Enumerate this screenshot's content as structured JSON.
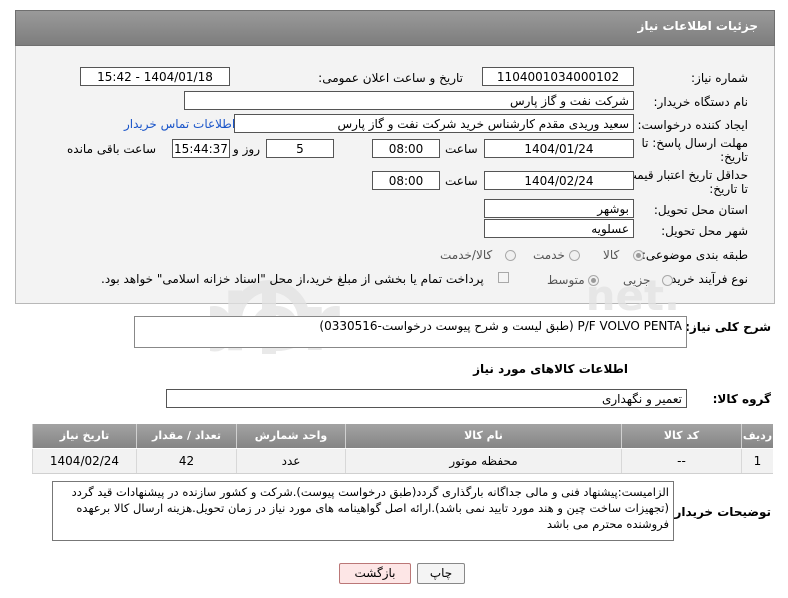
{
  "header": {
    "title": "جزئیات اطلاعات نیاز"
  },
  "fields": {
    "need_number_label": "شماره نیاز:",
    "need_number": "1104001034000102",
    "announce_label": "تاریخ و ساعت اعلان عمومی:",
    "announce_value": "1404/01/18 - 15:42",
    "buyer_org_label": "نام دستگاه خریدار:",
    "buyer_org": "شرکت نفت و گاز پارس",
    "creator_label": "ایجاد کننده درخواست:",
    "creator": "سعید وریدی مقدم کارشناس خرید شرکت نفت و گاز پارس",
    "contact_link": "اطلاعات تماس خریدار",
    "reply_deadline_label_1": "مهلت ارسال پاسخ: تا",
    "reply_deadline_label_2": "تاریخ:",
    "reply_date": "1404/01/24",
    "hour_label": "ساعت",
    "reply_time": "08:00",
    "days_value": "5",
    "days_label": "روز و",
    "remaining_time": "15:44:37",
    "remaining_label": "ساعت باقی مانده",
    "price_valid_label_1": "حداقل تاریخ اعتبار قیمت:",
    "price_valid_label_2": "تا تاریخ:",
    "price_date": "1404/02/24",
    "price_time": "08:00",
    "province_label": "استان محل تحویل:",
    "province": "بوشهر",
    "city_label": "شهر محل تحویل:",
    "city": "عسلویه",
    "category_label": "طبقه بندی موضوعی:",
    "category_options": [
      "کالا",
      "خدمت",
      "کالا/خدمت"
    ],
    "process_label": "نوع فرآیند خرید :",
    "process_options": [
      "جزیی",
      "متوسط"
    ],
    "payment_note": "پرداخت تمام یا بخشی از مبلغ خرید،از محل \"اسناد خزانه اسلامی\" خواهد بود."
  },
  "summary": {
    "label": "شرح کلی نیاز:",
    "value": "P/F VOLVO PENTA (طبق لیست و شرح پیوست درخواست-0330516)"
  },
  "goods": {
    "section_title": "اطلاعات کالاهای مورد نیاز",
    "group_label": "گروه کالا:",
    "group_value": "تعمیر و نگهداری",
    "columns": [
      "ردیف",
      "کد کالا",
      "نام کالا",
      "واحد شمارش",
      "تعداد / مقدار",
      "تاریخ نیاز"
    ],
    "rows": [
      [
        "1",
        "--",
        "محفظه موتور",
        "عدد",
        "42",
        "1404/02/24"
      ]
    ]
  },
  "notes": {
    "label": "توضیحات خریدار:",
    "text": "الزامیست:پیشنهاد فنی و مالی  جداگانه بارگذاری گردد(طبق درخواست پیوست).شرکت و کشور سازنده در پیشنهادات قید گردد (تجهیزات ساخت چین و هند مورد تایید نمی باشد).ارائه اصل گواهینامه های مورد نیاز در زمان تحویل.هزینه ارسال کالا برعهده فروشنده محترم می باشد"
  },
  "buttons": {
    "print": "چاپ",
    "back": "بازگشت"
  }
}
